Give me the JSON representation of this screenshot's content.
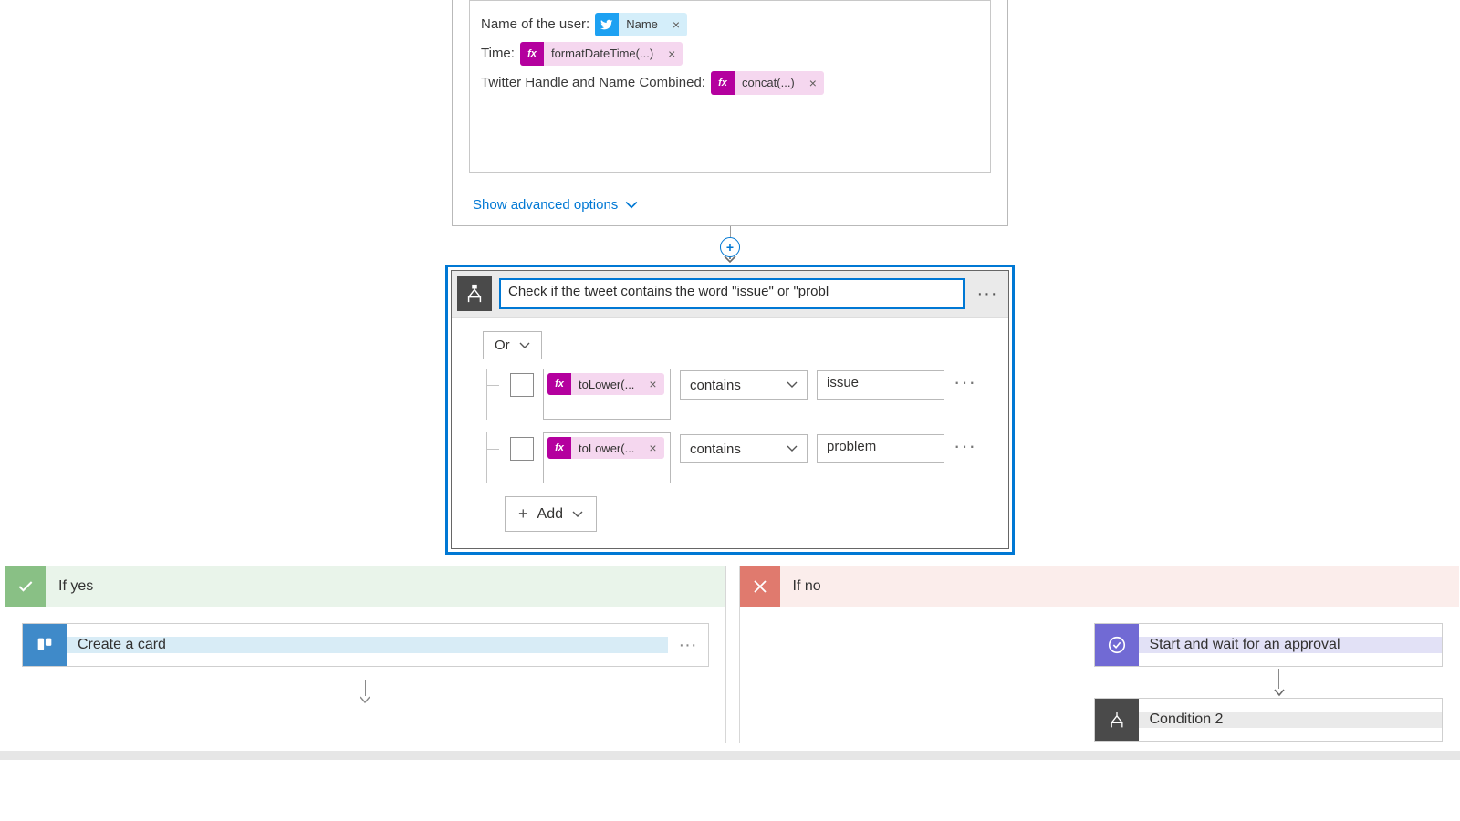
{
  "body_box": {
    "rows": [
      {
        "label": "Name of the user:",
        "token": {
          "kind": "tw",
          "text": "Name"
        }
      },
      {
        "label": "Time:",
        "token": {
          "kind": "fx",
          "text": "formatDateTime(...)"
        }
      },
      {
        "label": "Twitter Handle and Name Combined:",
        "token": {
          "kind": "fx",
          "text": "concat(...)"
        }
      }
    ]
  },
  "advanced": {
    "label": "Show advanced options"
  },
  "condition": {
    "title_value": "Check if the tweet contains the word \"issue\" or \"probl",
    "group_operator": "Or",
    "rows": [
      {
        "expr_token": "toLower(...",
        "operator": "contains",
        "value": "issue"
      },
      {
        "expr_token": "toLower(...",
        "operator": "contains",
        "value": "problem"
      }
    ],
    "add_label": "Add"
  },
  "branches": {
    "yes": {
      "label": "If yes",
      "actions": [
        {
          "type": "trello",
          "title": "Create a card"
        }
      ]
    },
    "no": {
      "label": "If no",
      "actions": [
        {
          "type": "approval",
          "title": "Start and wait for an approval"
        },
        {
          "type": "cond",
          "title": "Condition 2"
        }
      ]
    }
  },
  "icons": {
    "fx": "fx",
    "close": "×",
    "plus": "+",
    "dots": "···"
  }
}
